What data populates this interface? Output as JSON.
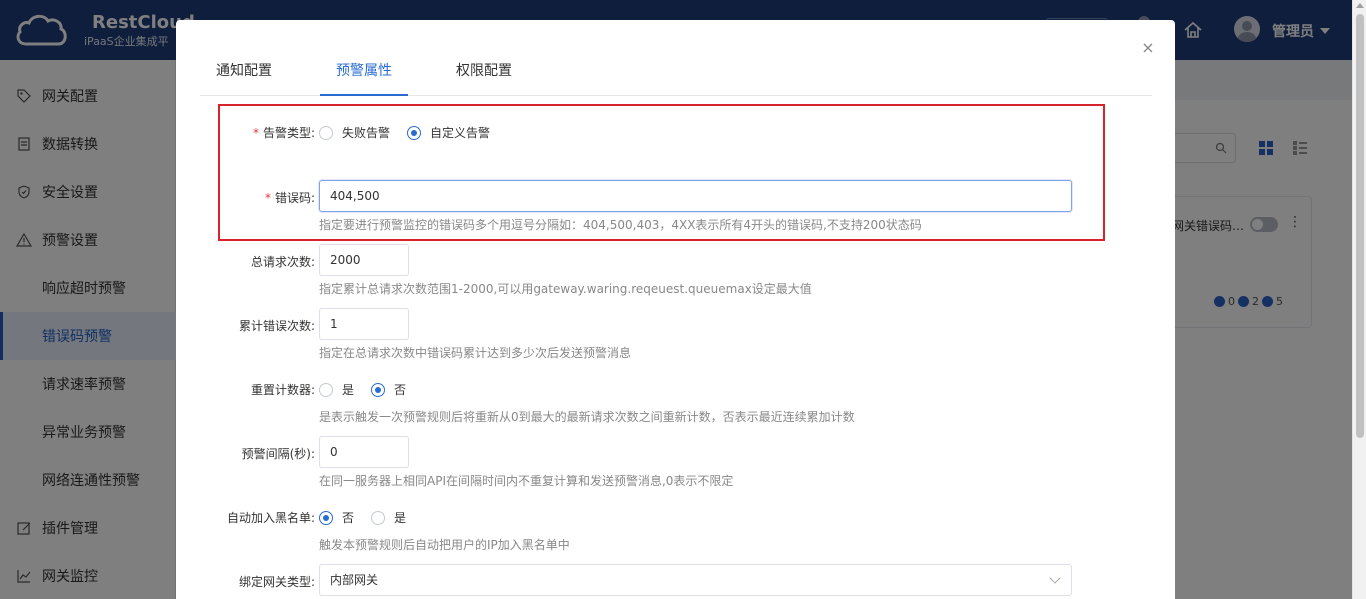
{
  "header": {
    "brand_title": "RestCloud",
    "brand_subtitle": "iPaaS企业集成平",
    "user_name": "管理员"
  },
  "sidebar": {
    "items": [
      {
        "label": "网关配置",
        "icon": "tag-icon"
      },
      {
        "label": "数据转换",
        "icon": "document-icon"
      },
      {
        "label": "安全设置",
        "icon": "shield-icon"
      },
      {
        "label": "预警设置",
        "icon": "warning-icon"
      },
      {
        "label": "响应超时预警",
        "sub": true
      },
      {
        "label": "错误码预警",
        "sub": true,
        "active": true
      },
      {
        "label": "请求速率预警",
        "sub": true
      },
      {
        "label": "异常业务预警",
        "sub": true
      },
      {
        "label": "网络连通性预警",
        "sub": true
      },
      {
        "label": "插件管理",
        "icon": "edit-icon"
      },
      {
        "label": "网关监控",
        "icon": "chart-icon"
      }
    ]
  },
  "background": {
    "card_title": "网关错误码…",
    "stats": [
      "0",
      "2",
      "5"
    ]
  },
  "modal": {
    "tabs": [
      {
        "label": "通知配置",
        "active": false
      },
      {
        "label": "预警属性",
        "active": true
      },
      {
        "label": "权限配置",
        "active": false
      }
    ],
    "close_glyph": "×",
    "required_mark": "*",
    "alert_type": {
      "label": "告警类型:",
      "options": [
        {
          "label": "失败告警",
          "checked": false
        },
        {
          "label": "自定义告警",
          "checked": true
        }
      ]
    },
    "error_code": {
      "label": "错误码:",
      "value": "404,500",
      "hint": "指定要进行预警监控的错误码多个用逗号分隔如：404,500,403，4XX表示所有4开头的错误码,不支持200状态码"
    },
    "total_requests": {
      "label": "总请求次数:",
      "value": "2000",
      "hint": "指定累计总请求次数范围1-2000,可以用gateway.waring.reqeuest.queuemax设定最大值"
    },
    "cumulative_errors": {
      "label": "累计错误次数:",
      "value": "1",
      "hint": "指定在总请求次数中错误码累计达到多少次后发送预警消息"
    },
    "reset_counter": {
      "label": "重置计数器:",
      "options": [
        {
          "label": "是",
          "checked": false
        },
        {
          "label": "否",
          "checked": true
        }
      ],
      "hint": "是表示触发一次预警规则后将重新从0到最大的最新请求次数之间重新计数，否表示最近连续累加计数"
    },
    "alert_interval": {
      "label": "预警间隔(秒):",
      "value": "0",
      "hint": "在同一服务器上相同API在间隔时间内不重复计算和发送预警消息,0表示不限定"
    },
    "auto_blacklist": {
      "label": "自动加入黑名单:",
      "options": [
        {
          "label": "否",
          "checked": true
        },
        {
          "label": "是",
          "checked": false
        }
      ],
      "hint": "触发本预警规则后自动把用户的IP加入黑名单中"
    },
    "gateway_type": {
      "label": "绑定网关类型:",
      "value": "内部网关"
    }
  }
}
